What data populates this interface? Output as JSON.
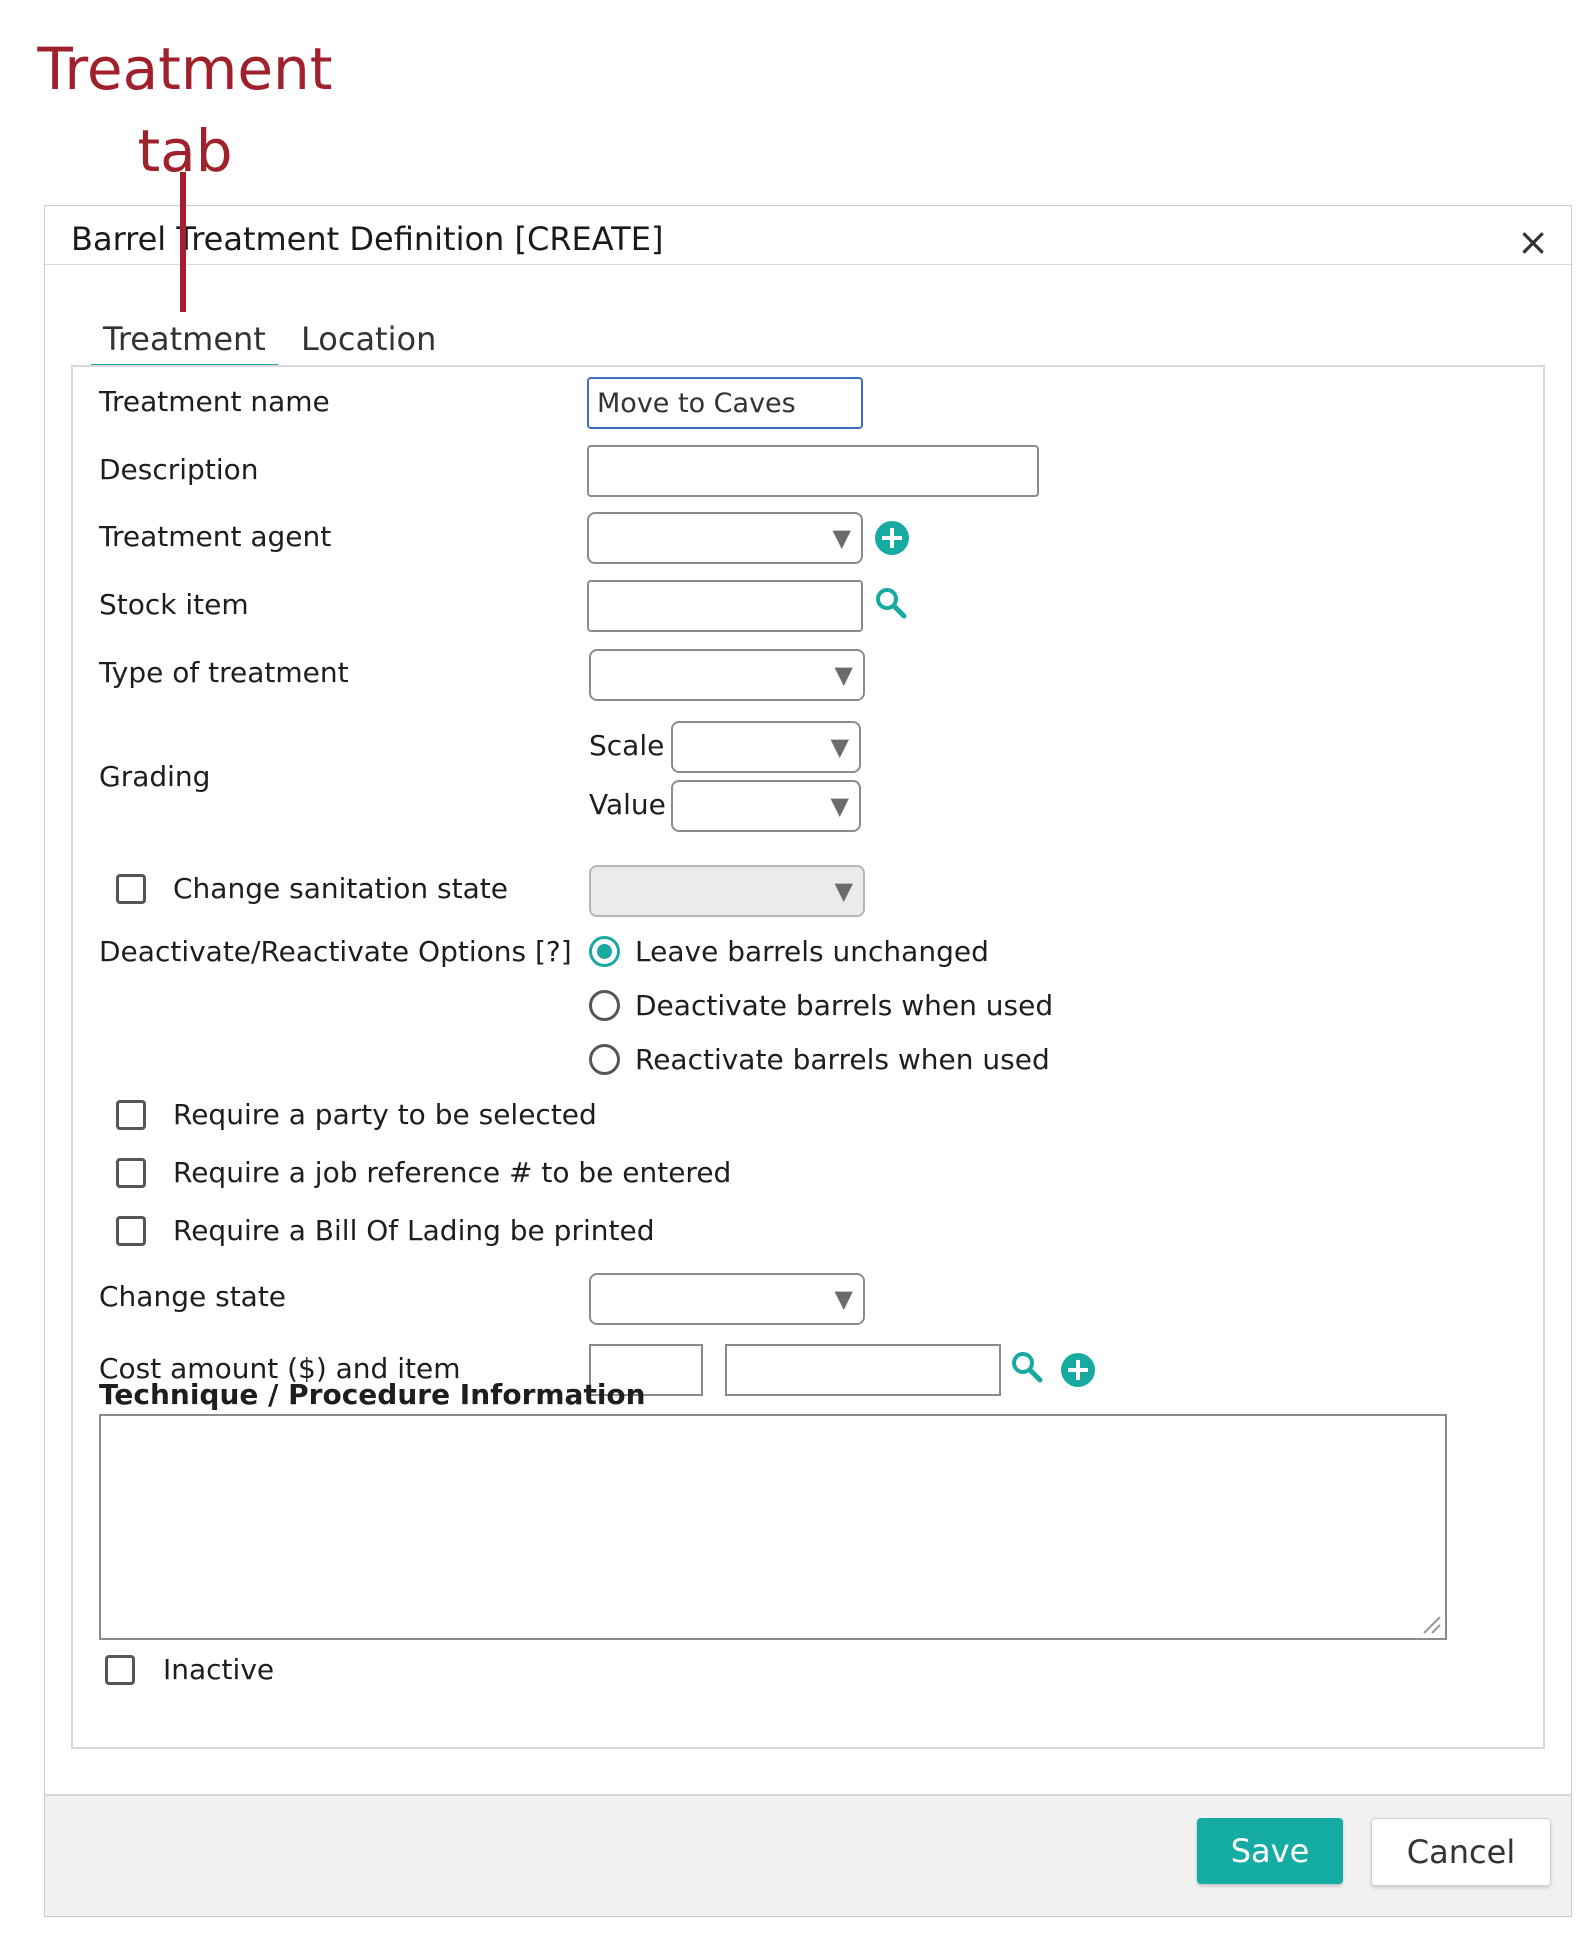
{
  "annotation": {
    "line1": "Treatment",
    "line2": "tab"
  },
  "dialog": {
    "title": "Barrel Treatment Definition [CREATE]",
    "close": "×",
    "tabs": [
      {
        "label": "Treatment",
        "active": true
      },
      {
        "label": "Location",
        "active": false
      }
    ]
  },
  "form": {
    "treatment_name": {
      "label": "Treatment name",
      "value": "Move to Caves"
    },
    "description": {
      "label": "Description",
      "value": ""
    },
    "treatment_agent": {
      "label": "Treatment agent",
      "value": ""
    },
    "stock_item": {
      "label": "Stock item",
      "value": ""
    },
    "type_of_treatment": {
      "label": "Type of treatment",
      "value": ""
    },
    "grading": {
      "label": "Grading",
      "scale_label": "Scale",
      "value_label": "Value",
      "scale": "",
      "value": ""
    },
    "change_sanitation_state": {
      "label": "Change sanitation state",
      "checked": false
    },
    "deactivate_options": {
      "label": "Deactivate/Reactivate Options [?]",
      "options": [
        {
          "label": "Leave barrels unchanged",
          "selected": true
        },
        {
          "label": "Deactivate barrels when used",
          "selected": false
        },
        {
          "label": "Reactivate barrels when used",
          "selected": false
        }
      ]
    },
    "require_party": {
      "label": "Require a party to be selected",
      "checked": false
    },
    "require_job_ref": {
      "label": "Require a job reference # to be entered",
      "checked": false
    },
    "require_bol": {
      "label": "Require a Bill Of Lading be printed",
      "checked": false
    },
    "change_state": {
      "label": "Change state",
      "value": ""
    },
    "cost_amount": {
      "label": "Cost amount ($) and item",
      "amount": "",
      "item": ""
    },
    "technique": {
      "label": "Technique / Procedure Information",
      "value": ""
    },
    "inactive": {
      "label": "Inactive",
      "checked": false
    }
  },
  "footer": {
    "save": "Save",
    "cancel": "Cancel"
  },
  "colors": {
    "accent": "#17aaa1",
    "annotation": "#a0202b",
    "save_button": "#15aca3"
  },
  "icons": {
    "dropdown": "▼",
    "add": "plus-circle-icon",
    "search": "search-icon"
  }
}
